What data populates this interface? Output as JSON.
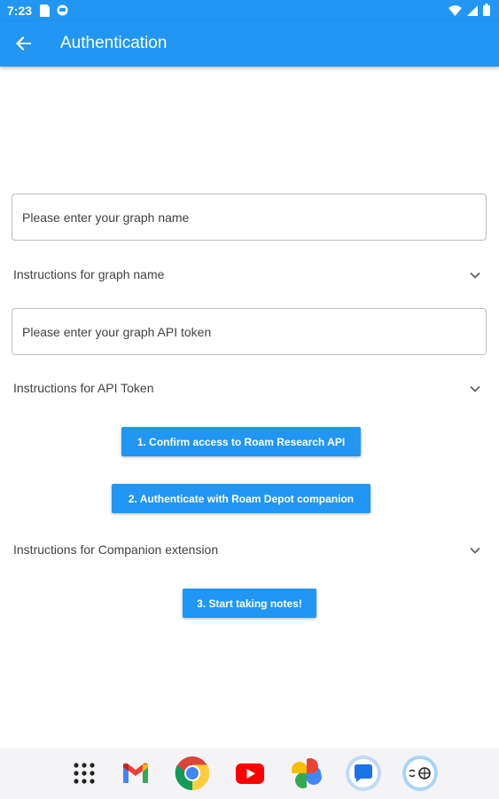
{
  "status_bar": {
    "time": "7:23"
  },
  "app_bar": {
    "title": "Authentication",
    "back_icon": "arrow-back-icon"
  },
  "form": {
    "graph_name_placeholder": "Please enter your graph name",
    "graph_name_value": "",
    "api_token_placeholder": "Please enter your graph API token",
    "api_token_value": ""
  },
  "expansions": {
    "graph_name_instructions": "Instructions for graph name",
    "api_token_instructions": "Instructions for API Token",
    "companion_instructions": "Instructions for Companion extension"
  },
  "buttons": {
    "confirm_access": "1. Confirm access to Roam Research API",
    "authenticate_companion": "2. Authenticate with Roam Depot companion",
    "start_notes": "3. Start taking notes!"
  },
  "dock": {
    "apps": [
      "app-drawer-icon",
      "gmail-icon",
      "chrome-icon",
      "youtube-icon",
      "photos-icon",
      "messages-icon",
      "roam-app-icon"
    ]
  },
  "colors": {
    "primary": "#2196F3",
    "text": "#424242",
    "border": "#bdbdbd"
  }
}
